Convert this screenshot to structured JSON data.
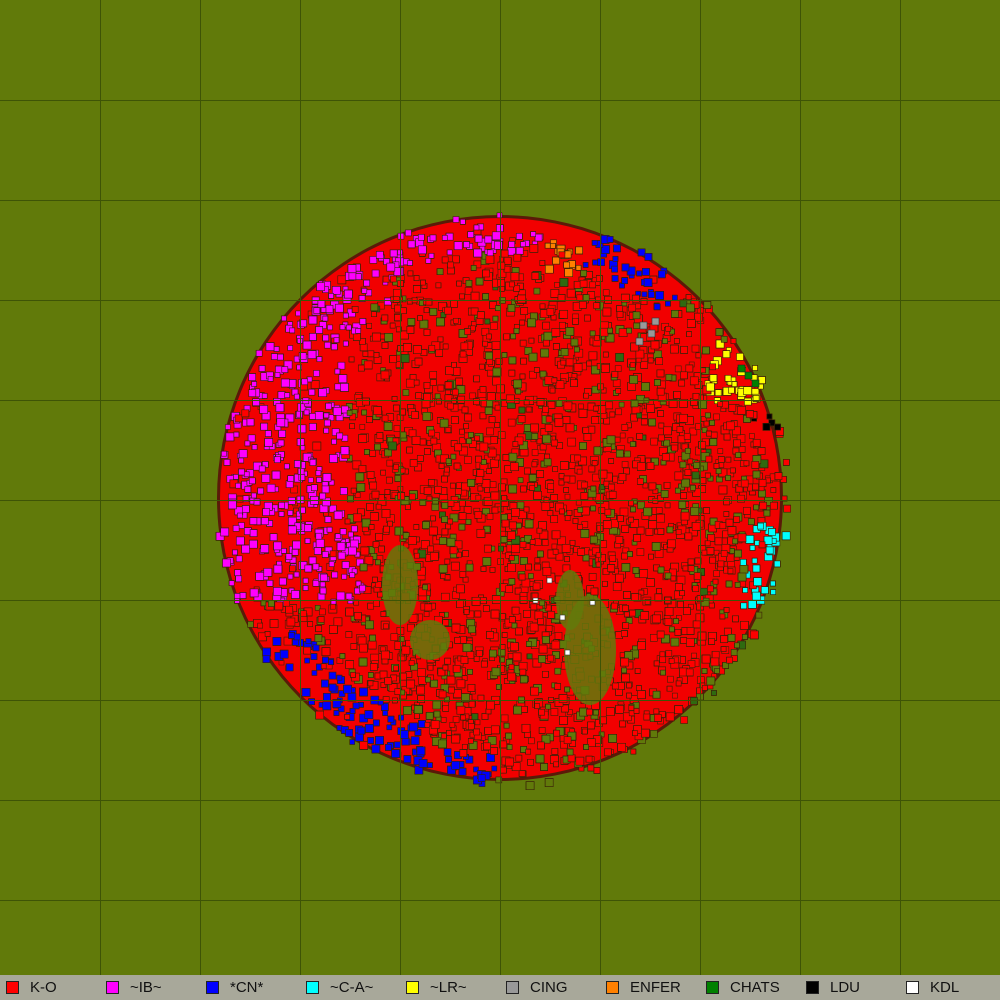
{
  "map": {
    "background_color": "#617a0a",
    "grid_color": "#3e5406",
    "land_outline_color": "#4a3a10"
  },
  "legend": {
    "items": [
      {
        "label": "K-O",
        "color": "#ff0000"
      },
      {
        "label": "~IB~",
        "color": "#ff00ff"
      },
      {
        "label": "*CN*",
        "color": "#0000ff"
      },
      {
        "label": "~C-A~",
        "color": "#00ffff"
      },
      {
        "label": "~LR~",
        "color": "#ffff00"
      },
      {
        "label": "CING",
        "color": "#999999"
      },
      {
        "label": "ENFER",
        "color": "#ff8000"
      },
      {
        "label": "CHATS",
        "color": "#008000"
      },
      {
        "label": "LDU",
        "color": "#000000"
      },
      {
        "label": "KDL",
        "color": "#ffffff"
      }
    ]
  }
}
